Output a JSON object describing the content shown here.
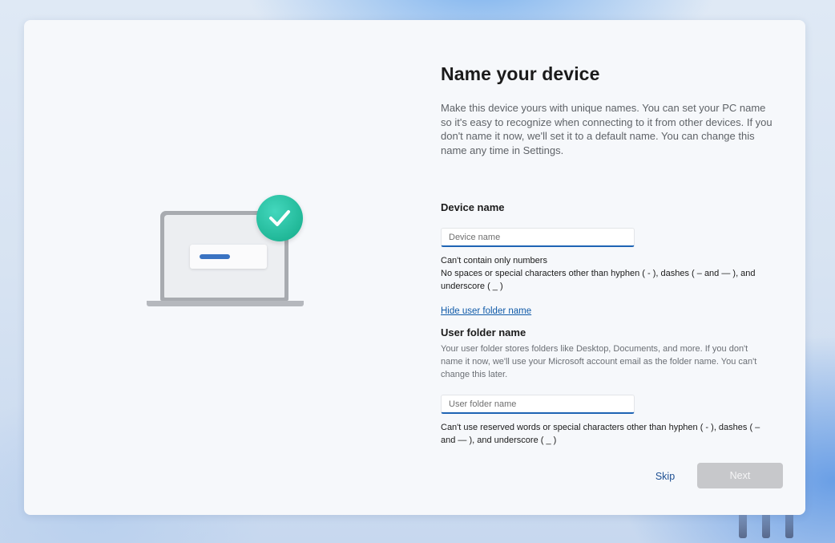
{
  "page": {
    "title": "Name your device",
    "description": "Make this device yours with unique names. You can set your PC name so it's easy to recognize when connecting to it from other devices. If you don't name it now, we'll set it to a default name. You can change this name any time in Settings."
  },
  "device": {
    "label": "Device name",
    "placeholder": "Device name",
    "value": "",
    "rule_line_1": "Can't contain only numbers",
    "rule_line_2": "No spaces or special characters other than hyphen ( - ), dashes ( – and — ), and underscore ( _ )"
  },
  "user_folder": {
    "toggle_link": "Hide user folder name",
    "label": "User folder name",
    "help": "Your user folder stores folders like Desktop, Documents, and more. If you don't name it now, we'll use your Microsoft account email as the folder name. You can't change this later.",
    "placeholder": "User folder name",
    "value": "",
    "rule": "Can't use reserved words or special characters other than hyphen ( - ), dashes ( – and — ), and underscore ( _ )"
  },
  "actions": {
    "skip_label": "Skip",
    "next_label": "Next"
  },
  "icons": {
    "illustration": "laptop-icon",
    "badge": "checkmark-icon"
  },
  "colors": {
    "accent": "#1e64b4",
    "link": "#0f5aa8",
    "badge": "#21b898",
    "disabled_button": "#c7c8cb"
  }
}
